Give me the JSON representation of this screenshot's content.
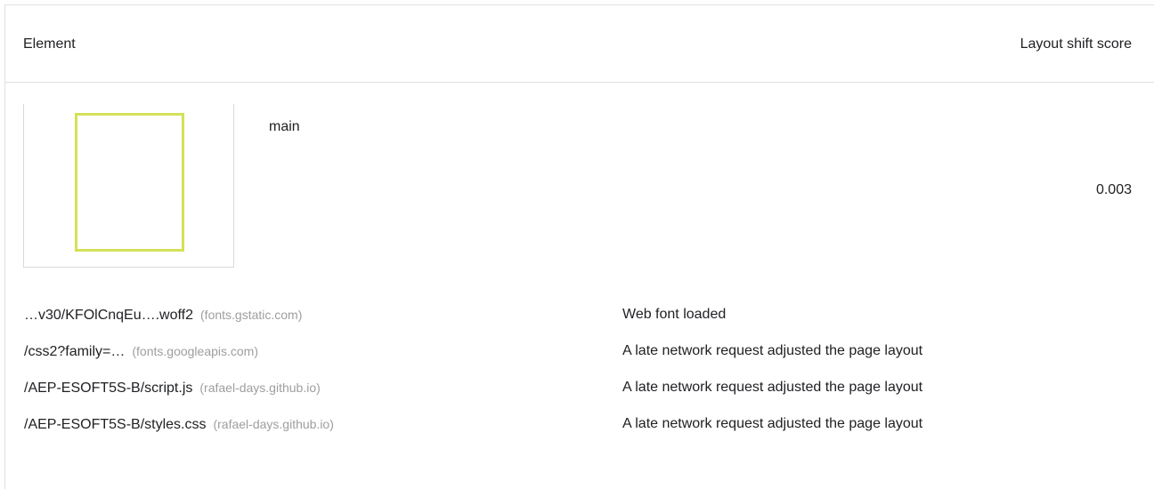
{
  "header": {
    "element_label": "Element",
    "score_label": "Layout shift score"
  },
  "item": {
    "node_label": "main",
    "score": "0.003",
    "thumbnail_highlight_color": "#d4e157"
  },
  "subitems": [
    {
      "url": "…v30/KFOlCnqEu….woff2",
      "origin": "(fonts.gstatic.com)",
      "reason": "Web font loaded"
    },
    {
      "url": "/css2?family=…",
      "origin": "(fonts.googleapis.com)",
      "reason": "A late network request adjusted the page layout"
    },
    {
      "url": "/AEP-ESOFT5S-B/script.js",
      "origin": "(rafael-days.github.io)",
      "reason": "A late network request adjusted the page layout"
    },
    {
      "url": "/AEP-ESOFT5S-B/styles.css",
      "origin": "(rafael-days.github.io)",
      "reason": "A late network request adjusted the page layout"
    }
  ]
}
